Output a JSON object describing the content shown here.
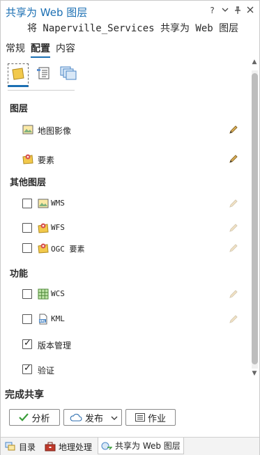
{
  "pane": {
    "title": "共享为 Web 图层",
    "subtitle": "将 Naperville_Services 共享为 Web 图层",
    "controls": {
      "help": "?",
      "dropdown": "⌄",
      "pin": "⊥",
      "close": "✕"
    }
  },
  "tabs": [
    {
      "label": "常规",
      "active": false
    },
    {
      "label": "配置",
      "active": true
    },
    {
      "label": "内容",
      "active": false
    }
  ],
  "icon_tabs": [
    {
      "icon": "layers-config-icon",
      "active": true
    },
    {
      "icon": "properties-list-icon",
      "active": false
    },
    {
      "icon": "pages-stack-icon",
      "active": false
    }
  ],
  "sections": {
    "layers": {
      "header": "图层",
      "items": [
        {
          "label": "地图影像",
          "icon": "map-image-icon",
          "editable": true
        },
        {
          "label": "要素",
          "icon": "feature-icon",
          "editable": true
        }
      ]
    },
    "other_layers": {
      "header": "其他图层",
      "items": [
        {
          "label": "WMS",
          "icon": "wms-icon",
          "checked": false,
          "editable": false
        },
        {
          "label": "WFS",
          "icon": "wfs-icon",
          "checked": false,
          "editable": false
        },
        {
          "label": "OGC 要素",
          "icon": "ogc-feature-icon",
          "checked": false,
          "editable": false
        }
      ]
    },
    "capabilities": {
      "header": "功能",
      "items": [
        {
          "label": "WCS",
          "icon": "wcs-grid-icon",
          "checked": false,
          "editable": false
        },
        {
          "label": "KML",
          "icon": "kml-icon",
          "checked": false,
          "editable": false
        },
        {
          "label": "版本管理",
          "checked": true
        },
        {
          "label": "验证",
          "checked": true
        }
      ]
    }
  },
  "finish": {
    "header": "完成共享",
    "analyze_label": "分析",
    "publish_label": "发布",
    "jobs_label": "作业"
  },
  "bottom_tabs": [
    {
      "label": "目录",
      "active": false
    },
    {
      "label": "地理处理",
      "active": false
    },
    {
      "label": "共享为 Web 图层",
      "active": true
    }
  ],
  "colors": {
    "accent": "#1b6fb3",
    "feature_yellow": "#f2c94c",
    "feature_red": "#d9534f",
    "check_green": "#3a9d3a"
  }
}
